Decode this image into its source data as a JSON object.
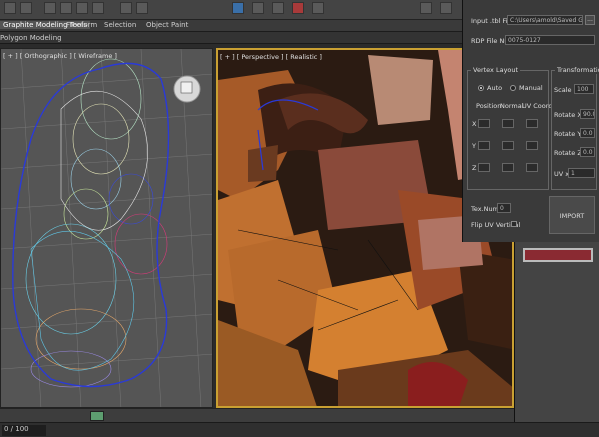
{
  "ribbon": {
    "tabs": [
      "Graphite Modeling Tools",
      "Freeform",
      "Selection",
      "Object Paint"
    ],
    "sub_label": "Polygon Modeling"
  },
  "viewports": {
    "left_label": "[ + ] [ Orthographic ] [ Wireframe ]",
    "right_label": "[ + ] [ Perspective ] [ Realistic ]"
  },
  "importer": {
    "input_label": "Input .tbl File:",
    "input_value": "C:\\Users\\amold\\Saved Games\\s",
    "browse_label": "...",
    "rdp_label": "RDP File Num:",
    "rdp_value": "0075-0127",
    "vertex_layout": {
      "title": "Vertex Layout",
      "auto_label": "Auto",
      "manual_label": "Manual",
      "columns": [
        "Position",
        "Normal",
        "UV Coord"
      ],
      "rows": [
        "X",
        "Y",
        "Z"
      ]
    },
    "transformations": {
      "title": "Transformations",
      "scale_label": "Scale",
      "scale_value": "100",
      "rotate_x_label": "Rotate X",
      "rotate_x_value": "90.0",
      "rotate_y_label": "Rotate Y",
      "rotate_y_value": "0.0",
      "rotate_z_label": "Rotate Z",
      "rotate_z_value": "0.0",
      "uv_label": "UV x",
      "uv_value": "1"
    },
    "tex_num_label": "Tex.Num",
    "tex_num_value": "0",
    "flip_uv_label": "Flip UV Vertical",
    "import_label": "IMPORT"
  },
  "timeline": {
    "frame_counter": "0 / 100"
  },
  "colors": {
    "accent": "#c9a032",
    "swatch": "#8a2a32"
  }
}
